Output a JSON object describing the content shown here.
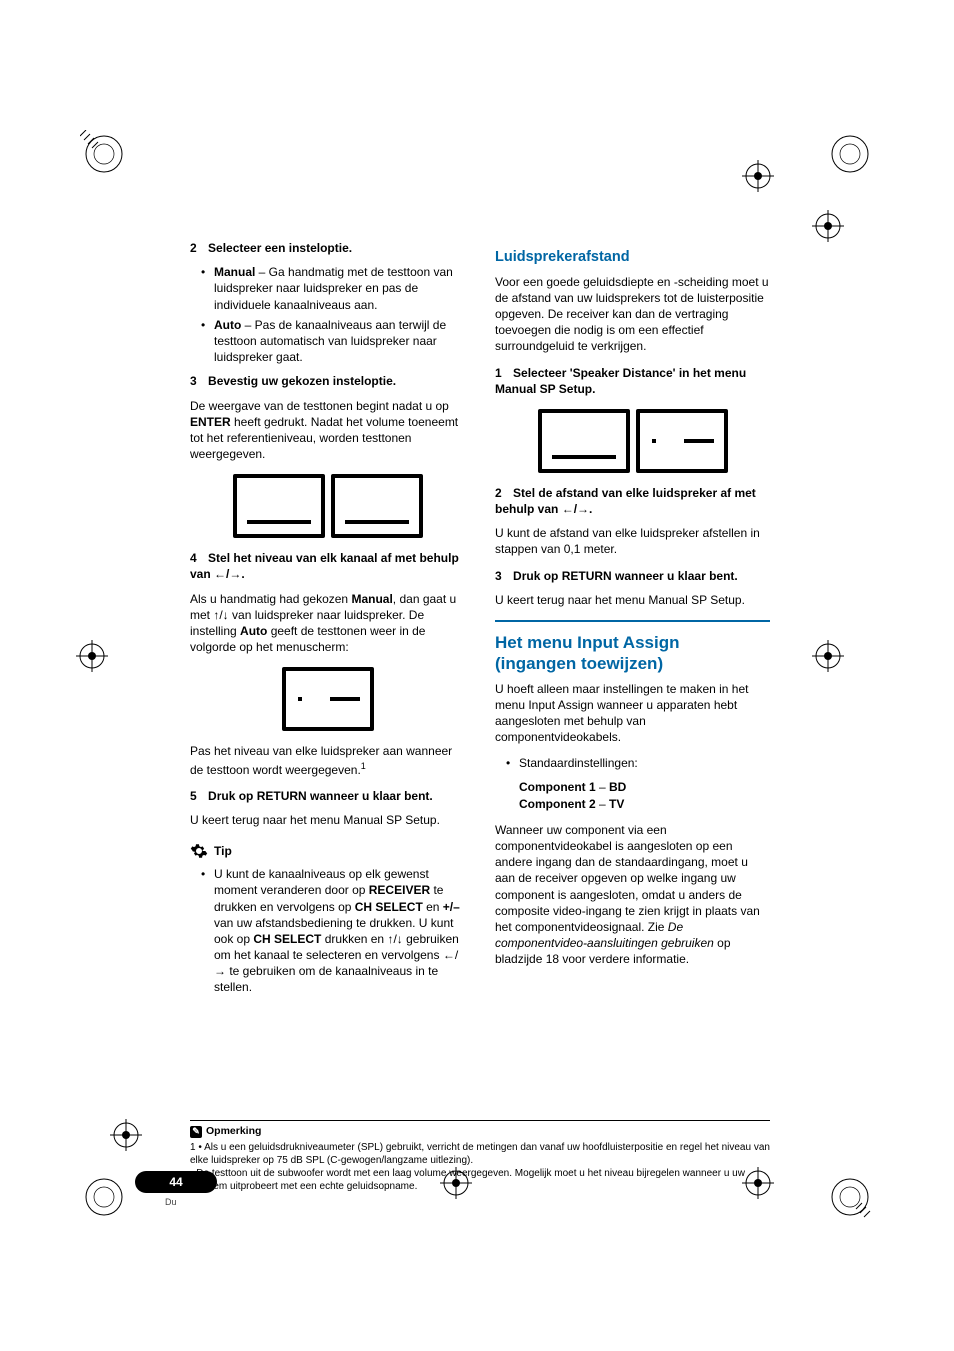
{
  "page": {
    "number": "44",
    "lang": "Du"
  },
  "left": {
    "step2": {
      "num": "2",
      "title": "Selecteer een insteloptie."
    },
    "opt_manual": {
      "label": "Manual",
      "text": " – Ga handmatig met de testtoon van luidspreker naar luidspreker en pas de individuele kanaalniveaus aan."
    },
    "opt_auto": {
      "label": "Auto",
      "text": " – Pas de kanaalniveaus aan terwijl de testtoon automatisch van luidspreker naar luidspreker gaat."
    },
    "step3": {
      "num": "3",
      "title": "Bevestig uw gekozen insteloptie."
    },
    "step3_body_a": "De weergave van de testtonen begint nadat u op ",
    "step3_enter": "ENTER",
    "step3_body_b": " heeft gedrukt. Nadat het volume toeneemt tot het referentieniveau, worden testtonen weergegeven.",
    "step4": {
      "num": "4",
      "title_a": "Stel het niveau van elk kanaal af met behulp van ",
      "arrows": "←/→",
      "title_b": "."
    },
    "step4_body_a": "Als u handmatig had gekozen ",
    "step4_manual": "Manual",
    "step4_body_b": ", dan gaat u met ",
    "step4_arrows_ud": "↑/↓",
    "step4_body_c": " van luidspreker naar luidspreker. De instelling ",
    "step4_auto": "Auto",
    "step4_body_d": " geeft de testtonen weer in de volgorde op het menuscherm:",
    "step4_body_e": "Pas het niveau van elke luidspreker aan wanneer de testtoon wordt weergegeven.",
    "step4_sup": "1",
    "step5": {
      "num": "5",
      "title": "Druk op RETURN wanneer u klaar bent."
    },
    "step5_body": "U keert terug naar het menu Manual SP Setup.",
    "tip_label": "Tip",
    "tip_a": "U kunt de kanaalniveaus op elk gewenst moment veranderen door op ",
    "tip_receiver": "RECEIVER",
    "tip_b": " te drukken en vervolgens op ",
    "tip_chselect": "CH SELECT",
    "tip_c": " en ",
    "tip_pm": "+/–",
    "tip_d": " van uw afstandsbediening te drukken. U kunt ook op ",
    "tip_chselect2": "CH SELECT",
    "tip_e": " drukken en ",
    "tip_ud": "↑/↓",
    "tip_f": " gebruiken om het kanaal te selecteren en vervolgens ",
    "tip_lr": "←/→",
    "tip_g": " te gebruiken om de kanaalniveaus in te stellen."
  },
  "right": {
    "h1": "Luidsprekerafstand",
    "intro": "Voor een goede geluidsdiepte en -scheiding moet u de afstand van uw luidsprekers tot de luisterpositie opgeven. De receiver kan dan de vertraging toevoegen die nodig is om een effectief surroundgeluid te verkrijgen.",
    "step1": {
      "num": "1",
      "title": "Selecteer 'Speaker Distance' in het menu Manual SP Setup."
    },
    "step2": {
      "num": "2",
      "title_a": "Stel de afstand van elke luidspreker af met behulp van ",
      "arrows": "←/→",
      "title_b": "."
    },
    "step2_body": "U kunt de afstand van elke luidspreker afstellen in stappen van 0,1 meter.",
    "step3": {
      "num": "3",
      "title": "Druk op RETURN wanneer u klaar bent."
    },
    "step3_body": "U keert terug naar het menu Manual SP Setup.",
    "h2_a": "Het menu Input Assign",
    "h2_b": "(ingangen toewijzen)",
    "ia_intro": "U hoeft alleen maar instellingen te maken in het menu Input Assign wanneer u apparaten hebt aangesloten met behulp van componentvideokabels.",
    "ia_bullet": "Standaardinstellingen:",
    "ia_c1a": "Component 1",
    "ia_c1b": " – ",
    "ia_c1c": "BD",
    "ia_c2a": "Component 2",
    "ia_c2b": " – ",
    "ia_c2c": "TV",
    "ia_body_a": "Wanneer uw component via een componentvideokabel is aangesloten op een andere ingang dan de standaardingang, moet u aan de receiver opgeven op welke ingang uw component is aangesloten, omdat u anders de composite video-ingang te zien krijgt in plaats van het componentvideosignaal. Zie ",
    "ia_body_link": "De componentvideo-aansluitingen gebruiken",
    "ia_body_b": " op bladzijde 18 voor verdere informatie."
  },
  "footnote": {
    "heading": "Opmerking",
    "n1": "1 • Als u een geluidsdrukniveaumeter (SPL) gebruikt, verricht de metingen dan vanaf uw hoofdluisterpositie en regel het niveau van elke luidspreker op 75 dB SPL (C-gewogen/langzame uitlezing).",
    "n2": "• De testtoon uit de subwoofer wordt met een laag volume weergegeven. Mogelijk moet u het niveau bijregelen wanneer u uw systeem uitprobeert met een echte geluidsopname."
  }
}
